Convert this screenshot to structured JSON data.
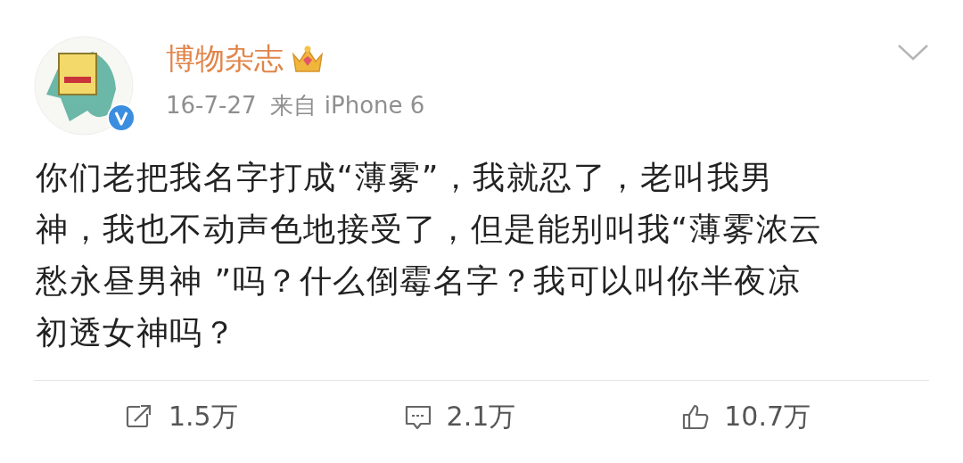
{
  "post": {
    "author": "博物杂志",
    "verified": true,
    "vip_crown": true,
    "time": "16-7-27",
    "source": "来自 iPhone 6",
    "body_lines": [
      "你们老把我名字打成“薄雾”，我就忍了，老叫我男",
      "神，我也不动声色地接受了，但是能别叫我“薄雾浓云",
      "愁永昼男神 ”吗？什么倒霉名字？我可以叫你半夜凉",
      "初透女神吗？"
    ]
  },
  "actions": [
    {
      "kind": "repost",
      "count": "1.5万"
    },
    {
      "kind": "comment",
      "count": "2.1万"
    },
    {
      "kind": "like",
      "count": "10.7万"
    }
  ]
}
